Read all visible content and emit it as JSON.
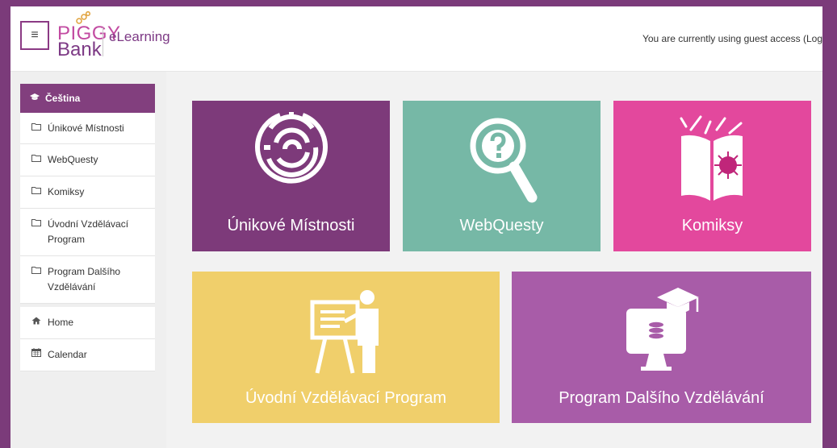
{
  "header": {
    "logo_piggy": "PIGGY",
    "logo_bank": "Bank",
    "logo_elearning": "eLearning",
    "guest_notice": "You are currently using guest access (Log"
  },
  "sidebar": {
    "header_label": "Čeština",
    "courses": [
      {
        "label": "Únikové Místnosti"
      },
      {
        "label": "WebQuesty"
      },
      {
        "label": "Komiksy"
      },
      {
        "label": "Úvodní Vzdělávací Program"
      },
      {
        "label": "Program Dalšího Vzdělávání"
      }
    ],
    "links": [
      {
        "label": "Home"
      },
      {
        "label": "Calendar"
      }
    ]
  },
  "tiles": [
    {
      "label": "Únikové Místnosti",
      "color": "#7d3a7a",
      "icon": "maze-icon"
    },
    {
      "label": "WebQuesty",
      "color": "#76b8a6",
      "icon": "magnifier-question-icon"
    },
    {
      "label": "Komiksy",
      "color": "#e3489d",
      "icon": "open-book-icon"
    },
    {
      "label": "Úvodní Vzdělávací Program",
      "color": "#f0cf6b",
      "icon": "presentation-icon"
    },
    {
      "label": "Program Dalšího Vzdělávání",
      "color": "#a85ca8",
      "icon": "graduation-monitor-icon"
    }
  ],
  "colors": {
    "page_border": "#7b3b7a",
    "accent": "#823f7e"
  }
}
